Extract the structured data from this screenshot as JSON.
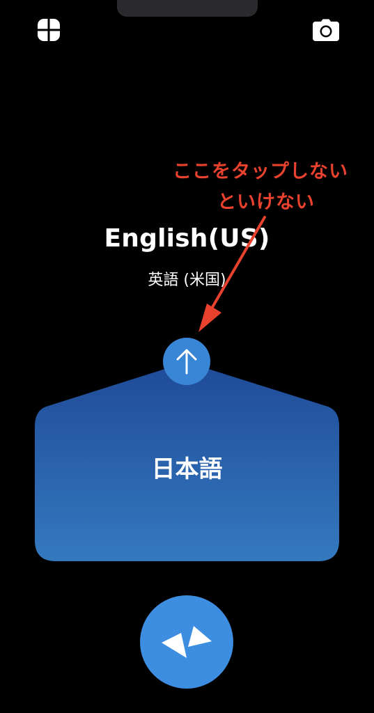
{
  "header": {
    "left_icon": "grid-icon",
    "right_icon": "camera-icon"
  },
  "target_language": {
    "name": "English(US)",
    "native_name": "英語 (米国)"
  },
  "annotation": {
    "line1": "ここをタップしない",
    "line2": "といけない",
    "color": "#e8412e"
  },
  "swap_button": {
    "icon": "arrow-up-icon"
  },
  "source_panel": {
    "label": "日本語",
    "gradient_top": "#1f4a97",
    "gradient_bottom": "#3479bf"
  },
  "mic_button": {
    "icon": "conversation-icon",
    "color": "#3d8ee0"
  }
}
